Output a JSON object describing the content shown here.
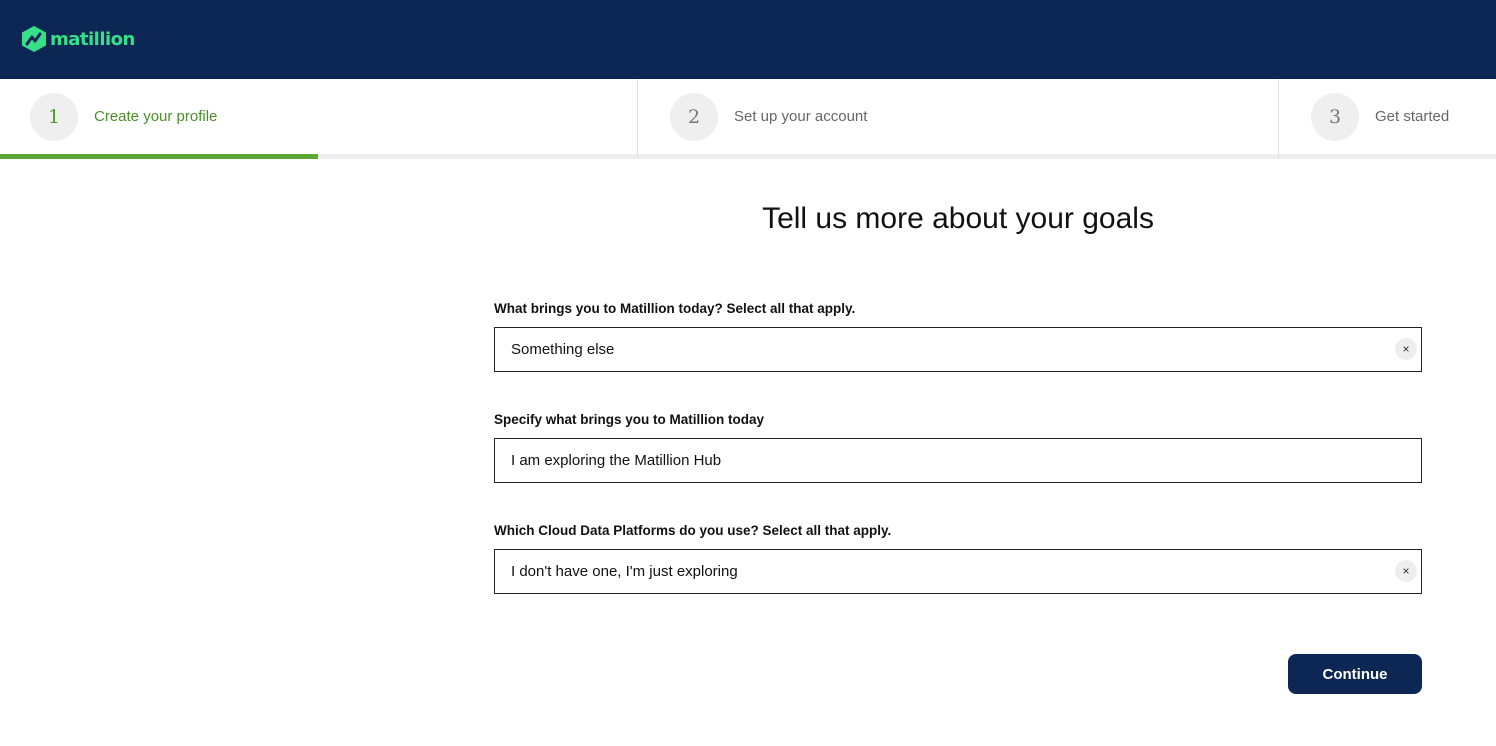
{
  "brand": {
    "name": "matillion",
    "logo_icon": "matillion-logo-icon",
    "colors": {
      "header": "#0d2755",
      "logo_green": "#37e086",
      "active_step": "#5aa832"
    }
  },
  "stepper": {
    "steps": [
      {
        "number": "1",
        "label": "Create your profile",
        "state": "active"
      },
      {
        "number": "2",
        "label": "Set up your account",
        "state": "upcoming"
      },
      {
        "number": "3",
        "label": "Get started",
        "state": "upcoming"
      }
    ],
    "progress_fraction": 0.2125
  },
  "form": {
    "title": "Tell us more about your goals",
    "fields": [
      {
        "label": "What brings you to Matillion today? Select all that apply.",
        "value": "Something else",
        "clear_icon": "×"
      },
      {
        "label": "Specify what brings you to Matillion today",
        "value": "I am exploring the Matillion Hub"
      },
      {
        "label": "Which Cloud Data Platforms do you use? Select all that apply.",
        "value": "I don't have one, I'm just exploring",
        "clear_icon": "×"
      }
    ],
    "continue_label": "Continue"
  }
}
